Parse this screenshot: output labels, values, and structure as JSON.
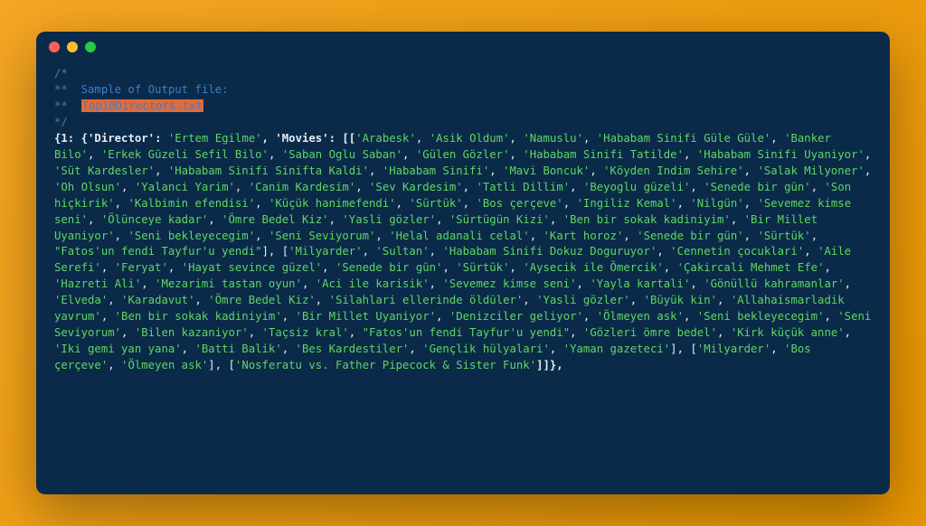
{
  "comment_lines": {
    "l1": "/*",
    "l2_prefix": "**  ",
    "l2_text": "Sample of Output file:",
    "l3_prefix": "**  ",
    "l3_hl": "Top10Directors.txt",
    "l4": "*/"
  },
  "dict_head": {
    "open": "{1: {",
    "k1": "'Director'",
    "sep1": ": ",
    "v1": "'Ertem Egilme'",
    "comma1": ", ",
    "k2": "'Movies'",
    "sep2": ": [[",
    "close_tail": "]]},"
  },
  "movies_a": [
    "Arabesk",
    "Asik Oldum",
    "Namuslu",
    "Hababam Sinifi Güle Güle",
    "Banker Bilo",
    "Erkek Güzeli Sefil Bilo",
    "Saban Oglu Saban",
    "Gülen Gözler",
    "Hababam Sinifi Tatilde",
    "Hababam Sinifi Uyaniyor",
    "Süt Kardesler",
    "Hababam Sinifi Sinifta Kaldi",
    "Hababam Sinifi",
    "Mavi Boncuk",
    "Köyden Indim Sehire",
    "Salak Milyoner",
    "Oh Olsun",
    "Yalanci Yarim",
    "Canim Kardesim",
    "Sev Kardesim",
    "Tatli Dillim",
    "Beyoglu güzeli",
    "Senede bir gün",
    "Son hiçkirik",
    "Kalbimin efendisi",
    "Küçük hanimefendi",
    "Sürtük",
    "Bos çerçeve",
    "Ingiliz Kemal",
    "Nilgün",
    "Sevemez kimse seni",
    "Ölünceye kadar",
    "Ömre Bedel Kiz",
    "Yasli gözler",
    "Sürtügün Kizi",
    "Ben bir sokak kadiniyim",
    "Bir Millet Uyaniyor",
    "Seni bekleyecegim",
    "Seni Seviyorum",
    "Helal adanali celal",
    "Kart horoz",
    "Senede bir gün",
    "Sürtük"
  ],
  "movies_a_tail_dq": "Fatos'un fendi Tayfur'u yendi",
  "movies_b": [
    "Milyarder",
    "Sultan",
    "Hababam Sinifi Dokuz Doguruyor",
    "Cennetin çocuklari",
    "Aile Serefi",
    "Feryat",
    "Hayat sevince güzel",
    "Senede bir gün",
    "Sürtük",
    "Aysecik ile Ömercik",
    "Çakircali Mehmet Efe",
    "Hazreti Ali",
    "Mezarimi tastan oyun",
    "Aci ile karisik",
    "Sevemez kimse seni",
    "Yayla kartali",
    "Gönüllü kahramanlar",
    "Elveda",
    "Karadavut",
    "Ömre Bedel Kiz",
    "Silahlari ellerinde öldüler",
    "Yasli gözler",
    "Büyük kin",
    "Allahaismarladik yavrum",
    "Ben bir sokak kadiniyim",
    "Bir Millet Uyaniyor",
    "Denizciler geliyor",
    "Ölmeyen ask",
    "Seni bekleyecegim",
    "Seni Seviyorum",
    "Bilen kazaniyor",
    "Taçsiz kral"
  ],
  "movies_b_tail_dq": "Fatos'un fendi Tayfur'u yendi",
  "movies_b_rest": [
    "Gözleri ömre bedel",
    "Kirk küçük anne",
    "Iki gemi yan yana",
    "Batti Balik",
    "Bes Kardestiler",
    "Gençlik hülyalari",
    "Yaman gazeteci"
  ],
  "movies_c": [
    "Milyarder",
    "Bos çerçeve",
    "Ölmeyen ask"
  ],
  "movies_d": [
    "Nosferatu vs. Father Pipecock & Sister Funk"
  ]
}
